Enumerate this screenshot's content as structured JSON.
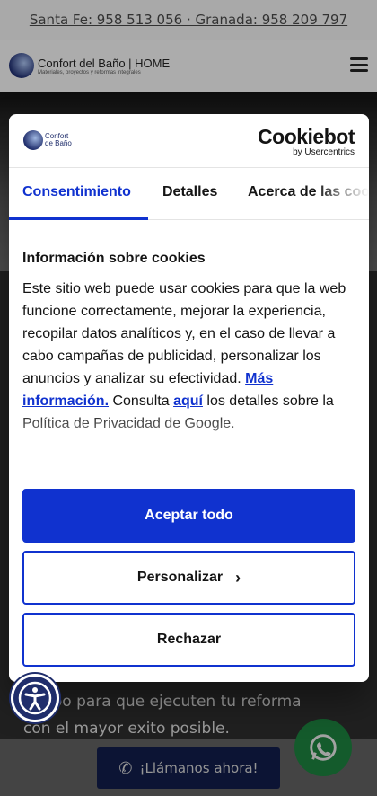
{
  "topbar": {
    "contact": "Santa Fe: 958 513 056 · Granada: 958 209 797"
  },
  "site": {
    "logo_main": "Confort del Baño | HOME",
    "logo_sub": "Materiales, proyectos y reformas integrales"
  },
  "hero": {
    "line1": "…uipo para que ejecuten tu reforma",
    "line2": "con el mayor exito posible."
  },
  "call_button": {
    "label": "¡Llámanos ahora!"
  },
  "dialog": {
    "brand_line1": "Confort",
    "brand_line2": "de Baño",
    "cookiebot_main": "Cookiebot",
    "cookiebot_sub": "by Usercentrics",
    "tabs": [
      {
        "label": "Consentimiento"
      },
      {
        "label": "Detalles"
      },
      {
        "label": "Acerca de las cookies"
      }
    ],
    "title": "Información sobre cookies",
    "text_part1": "Este sitio web puede usar cookies para que la web funcione correctamente, mejorar la experiencia, recopilar datos analíticos y, en el caso de llevar a cabo campañas de publicidad, personalizar los anuncios y analizar su efectividad. ",
    "link_more": "Más información.",
    "text_part2": " Consulta ",
    "link_here": "aquí",
    "text_part3": " los detalles sobre la Política de Privacidad de Google.",
    "accept_label": "Aceptar todo",
    "customize_label": "Personalizar",
    "reject_label": "Rechazar"
  },
  "colors": {
    "accent": "#1032cf",
    "brand_navy": "#1f2d6b",
    "whatsapp": "#25d366"
  },
  "icons": [
    "hamburger-icon",
    "phone-icon",
    "whatsapp-icon",
    "accessibility-icon",
    "chevron-right-icon"
  ]
}
